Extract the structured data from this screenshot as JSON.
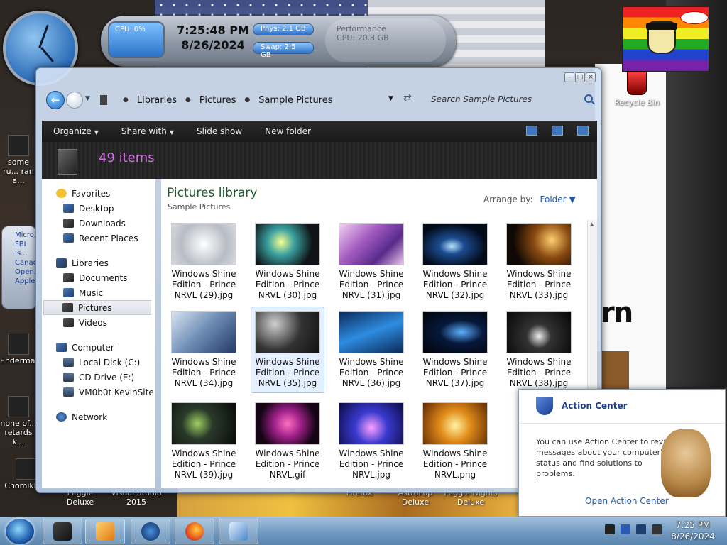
{
  "gadgets": {
    "cpu_label": "CPU: 0%",
    "time": "7:25:48 PM",
    "date": "8/26/2024",
    "phys": "Phys: 2.1 GB",
    "swap": "Swap: 2.5 GB",
    "ghost_label": "Performance",
    "ghost_cpu": "CPU: 20.3 GB"
  },
  "desktop": {
    "icons": [
      {
        "label": "some ru... ran a..."
      },
      {
        "label": "Enderma..."
      },
      {
        "label": "none of... retards k..."
      },
      {
        "label": "Chomikbox"
      },
      {
        "label": "Peggle Deluxe"
      },
      {
        "label": "Visual Studio 2015"
      },
      {
        "label": "Firefox"
      },
      {
        "label": "AstroPop Deluxe"
      },
      {
        "label": "Peggle Nights Deluxe"
      }
    ],
    "recycle_bin": "Recycle Bin",
    "widget_lines": [
      "Micro...",
      "FBI Is...",
      "Canad...",
      "Open...",
      "Apple..."
    ],
    "big_text": "rn"
  },
  "window": {
    "breadcrumb": [
      "Libraries",
      "Pictures",
      "Sample Pictures"
    ],
    "search_placeholder": "Search Sample Pictures",
    "toolbar": {
      "organize": "Organize",
      "share_with": "Share with",
      "slide_show": "Slide show",
      "new_folder": "New folder"
    },
    "item_count": "49 items",
    "sidebar": {
      "favorites": {
        "label": "Favorites",
        "items": [
          "Desktop",
          "Downloads",
          "Recent Places"
        ]
      },
      "libraries": {
        "label": "Libraries",
        "items": [
          "Documents",
          "Music",
          "Pictures",
          "Videos"
        ]
      },
      "computer": {
        "label": "Computer",
        "items": [
          "Local Disk (C:)",
          "CD Drive (E:)",
          "VM0b0t KevinSite"
        ]
      },
      "network": {
        "label": "Network"
      }
    },
    "content": {
      "title": "Pictures library",
      "subtitle": "Sample Pictures",
      "arrange_label": "Arrange by:",
      "arrange_value": "Folder"
    },
    "files": [
      [
        "Windows Shine",
        "Edition - Prince",
        "NRVL (29).jpg"
      ],
      [
        "Windows Shine",
        "Edition - Prince",
        "NRVL (30).jpg"
      ],
      [
        "Windows Shine",
        "Edition - Prince",
        "NRVL (31).jpg"
      ],
      [
        "Windows Shine",
        "Edition - Prince",
        "NRVL (32).jpg"
      ],
      [
        "Windows Shine",
        "Edition - Prince",
        "NRVL (33).jpg"
      ],
      [
        "Windows Shine",
        "Edition - Prince",
        "NRVL (34).jpg"
      ],
      [
        "Windows Shine",
        "Edition - Prince",
        "NRVL (35).jpg"
      ],
      [
        "Windows Shine",
        "Edition - Prince",
        "NRVL (36).jpg"
      ],
      [
        "Windows Shine",
        "Edition - Prince",
        "NRVL (37).jpg"
      ],
      [
        "Windows Shine",
        "Edition - Prince",
        "NRVL (38).jpg"
      ],
      [
        "Windows Shine",
        "Edition - Prince",
        "NRVL (39).jpg"
      ],
      [
        "Windows Shine",
        "Edition - Prince",
        "NRVL.gif"
      ],
      [
        "Windows Shine",
        "Edition - Prince",
        "NRVL.jpg"
      ],
      [
        "Windows Shine",
        "Edition - Prince",
        "NRVL.png"
      ]
    ]
  },
  "action_center": {
    "title": "Action Center",
    "message": "You can use Action Center to review messages about your computer's status and find solutions to problems.",
    "link": "Open Action Center"
  },
  "taskbar": {
    "time": "7:25 PM",
    "date": "8/26/2024"
  }
}
